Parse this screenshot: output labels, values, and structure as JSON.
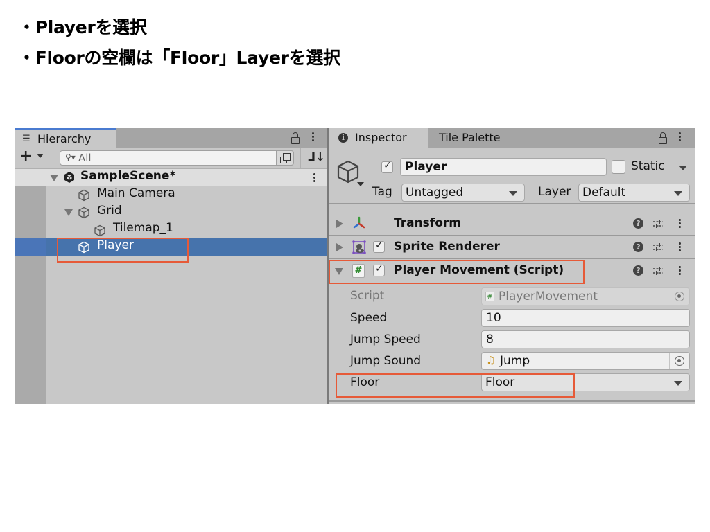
{
  "instructions": [
    "・Playerを選択",
    "・Floorの空欄は「Floor」Layerを選択"
  ],
  "hierarchy": {
    "tab_label": "Hierarchy",
    "search_placeholder": "All",
    "scene": "SampleScene*",
    "items": [
      {
        "label": "Main Camera",
        "depth": 1,
        "expandable": false,
        "selected": false
      },
      {
        "label": "Grid",
        "depth": 1,
        "expandable": true,
        "expanded": true,
        "selected": false
      },
      {
        "label": "Tilemap_1",
        "depth": 2,
        "expandable": false,
        "selected": false
      },
      {
        "label": "Player",
        "depth": 1,
        "expandable": false,
        "selected": true
      }
    ]
  },
  "inspector": {
    "tabs": [
      {
        "label": "Inspector",
        "active": true
      },
      {
        "label": "Tile Palette",
        "active": false
      }
    ],
    "gameobject": {
      "active": true,
      "name": "Player",
      "static_label": "Static",
      "static": false,
      "tag_label": "Tag",
      "tag": "Untagged",
      "layer_label": "Layer",
      "layer": "Default"
    },
    "components": [
      {
        "title": "Transform",
        "expanded": false,
        "has_checkbox": false,
        "icon": "transform-icon"
      },
      {
        "title": "Sprite Renderer",
        "expanded": false,
        "has_checkbox": true,
        "enabled": true,
        "icon": "sprite-renderer-icon"
      },
      {
        "title": "Player Movement (Script)",
        "expanded": true,
        "has_checkbox": true,
        "enabled": true,
        "icon": "script-icon"
      }
    ],
    "properties": [
      {
        "label": "Script",
        "value": "PlayerMovement",
        "readonly": true
      },
      {
        "label": "Speed",
        "value": "10"
      },
      {
        "label": "Jump Speed",
        "value": "8"
      },
      {
        "label": "Jump Sound",
        "value": "Jump"
      },
      {
        "label": "Floor",
        "value": "Floor"
      }
    ]
  },
  "colors": {
    "highlight_box": "#e65a38",
    "selection": "#4673ac",
    "panel_bg": "#c8c8c8"
  }
}
